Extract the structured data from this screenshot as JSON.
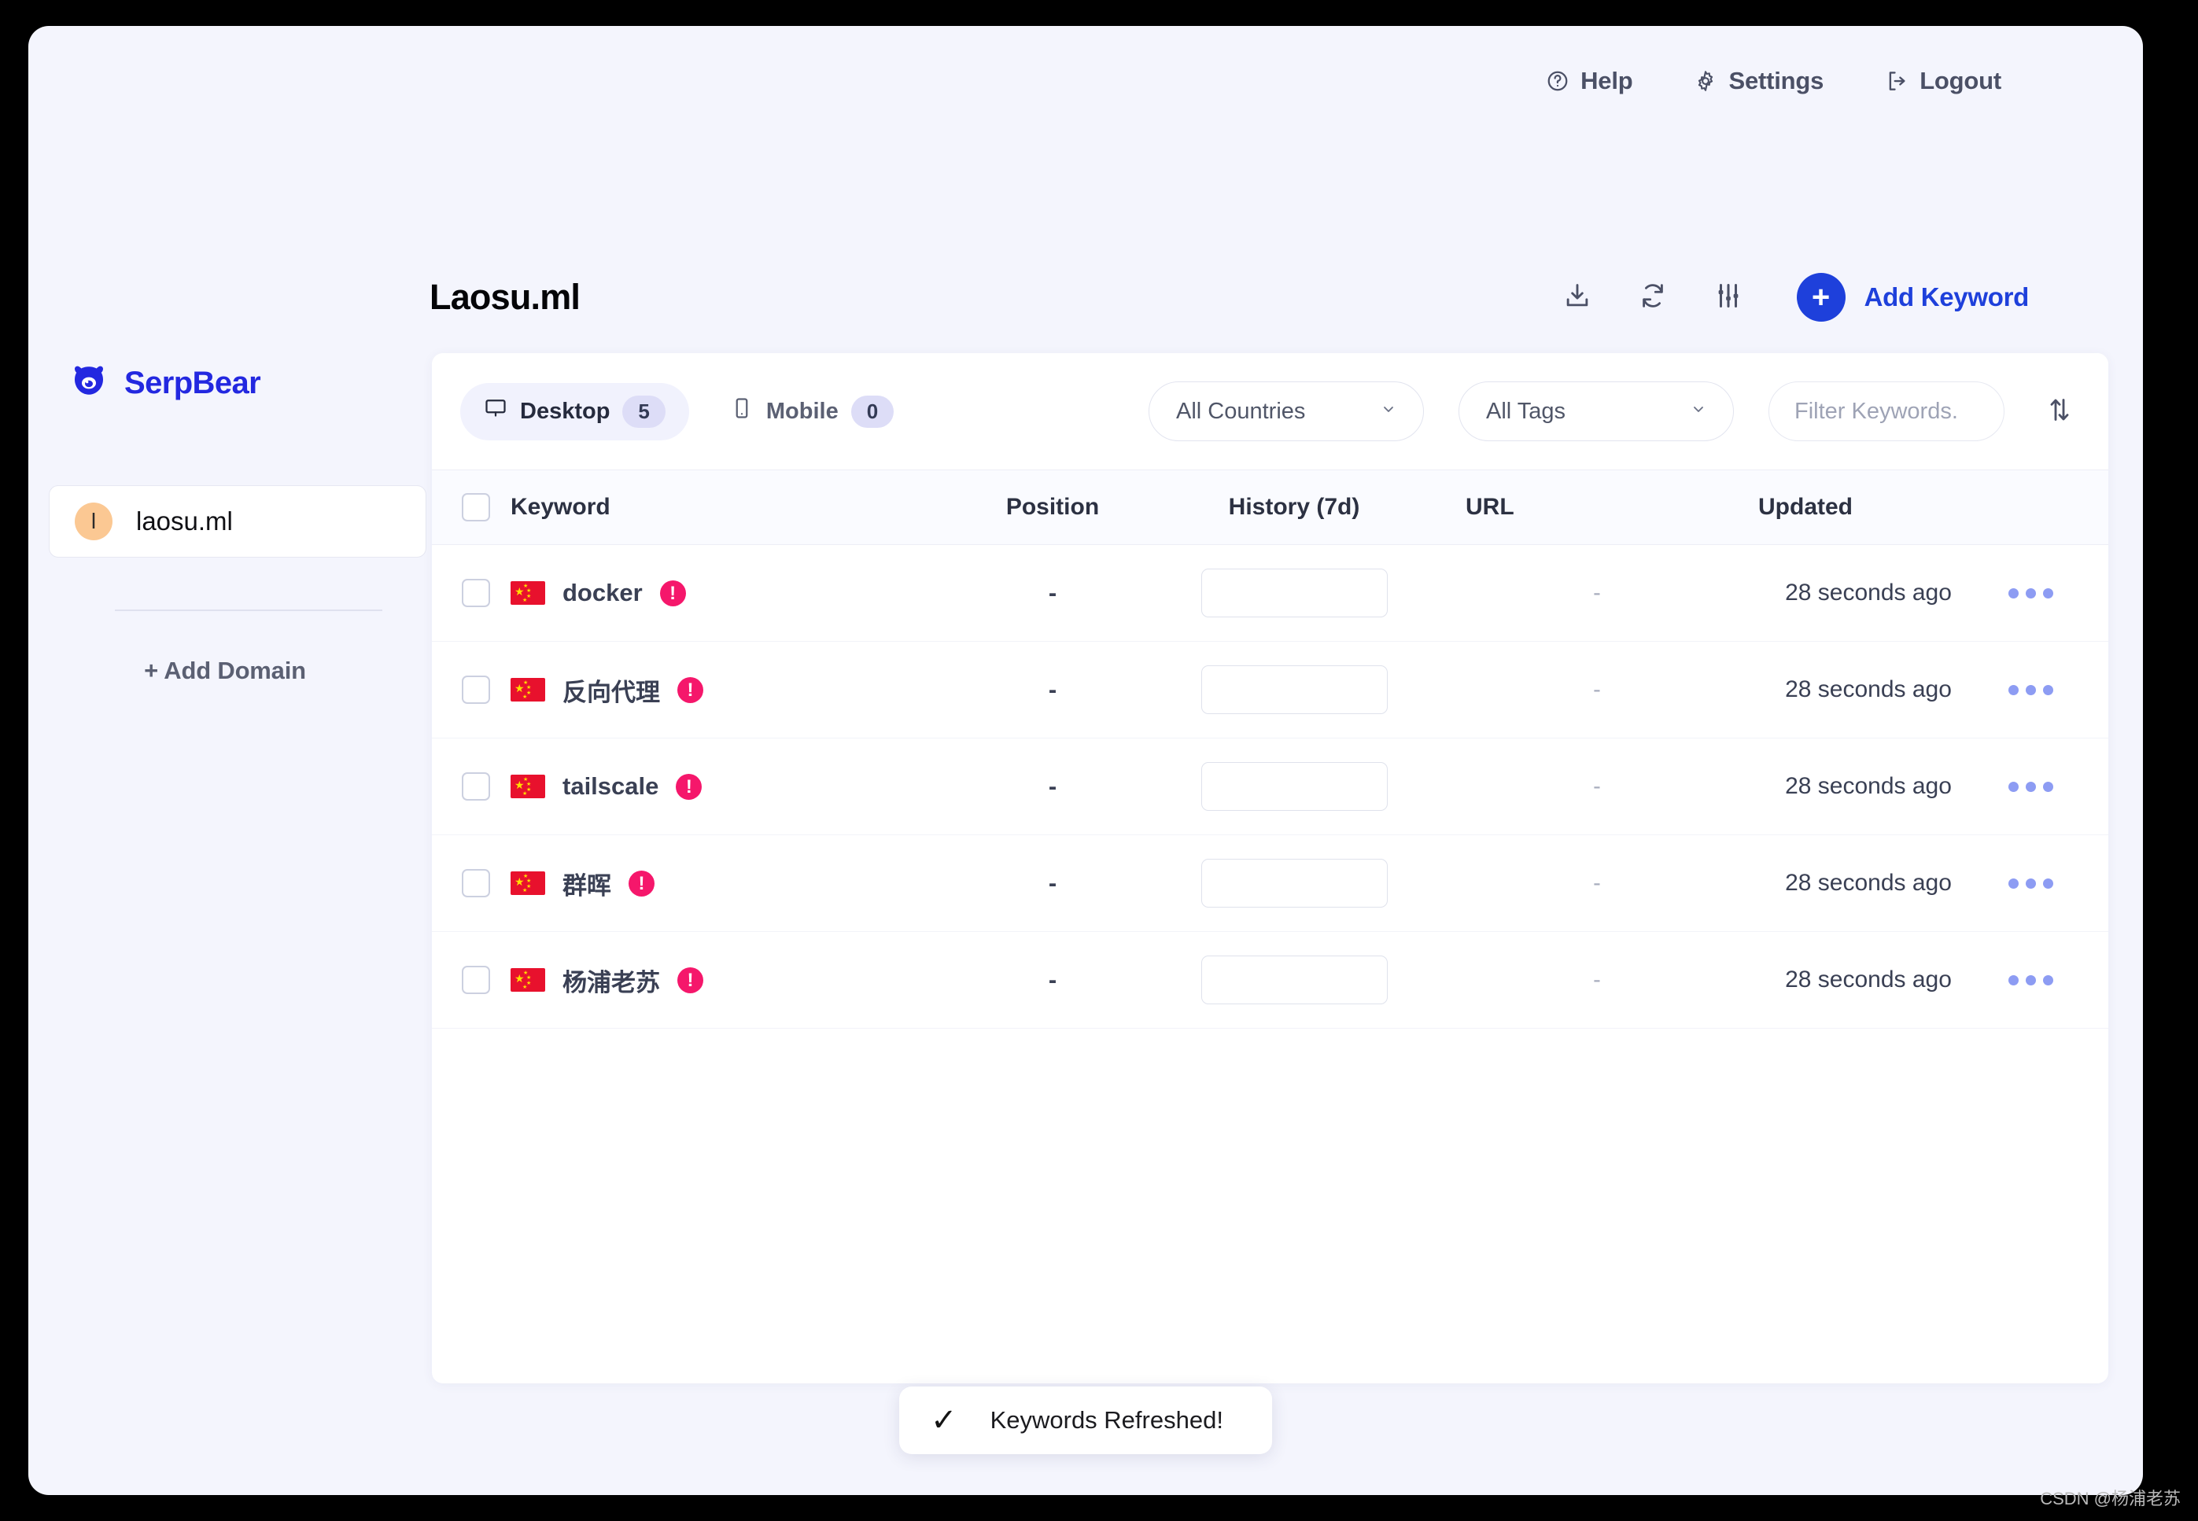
{
  "topnav": {
    "items": [
      {
        "label": "Help",
        "icon": "help-circle-icon"
      },
      {
        "label": "Settings",
        "icon": "gear-icon"
      },
      {
        "label": "Logout",
        "icon": "logout-icon"
      }
    ]
  },
  "sidebar": {
    "brand": "SerpBear",
    "domains": [
      {
        "avatar_letter": "l",
        "label": "laosu.ml"
      }
    ],
    "add_domain_label": "+ Add Domain"
  },
  "header": {
    "title": "Laosu.ml",
    "actions": [
      {
        "name": "export-button",
        "icon": "download-icon"
      },
      {
        "name": "refresh-button",
        "icon": "refresh-icon"
      },
      {
        "name": "settings-sliders-button",
        "icon": "sliders-icon"
      }
    ],
    "add_keyword_plus": "+",
    "add_keyword_label": "Add Keyword"
  },
  "toolbar": {
    "tabs": [
      {
        "label": "Desktop",
        "count": "5",
        "icon": "desktop-icon",
        "active": true
      },
      {
        "label": "Mobile",
        "count": "0",
        "icon": "mobile-icon",
        "active": false
      }
    ],
    "country_filter": "All Countries",
    "tag_filter": "All Tags",
    "search_placeholder": "Filter Keywords.",
    "search_value": "",
    "sort_icon": "sort-arrows-icon"
  },
  "table": {
    "columns": [
      "Keyword",
      "Position",
      "History (7d)",
      "URL",
      "Updated"
    ],
    "rows": [
      {
        "keyword": "docker",
        "country": "CN",
        "position": "-",
        "url": "-",
        "updated": "28 seconds ago"
      },
      {
        "keyword": "反向代理",
        "country": "CN",
        "position": "-",
        "url": "-",
        "updated": "28 seconds ago"
      },
      {
        "keyword": "tailscale",
        "country": "CN",
        "position": "-",
        "url": "-",
        "updated": "28 seconds ago"
      },
      {
        "keyword": "群晖",
        "country": "CN",
        "position": "-",
        "url": "-",
        "updated": "28 seconds ago"
      },
      {
        "keyword": "杨浦老苏",
        "country": "CN",
        "position": "-",
        "url": "-",
        "updated": "28 seconds ago"
      }
    ]
  },
  "toast": {
    "check": "✓",
    "message": "Keywords Refreshed!"
  },
  "watermark": "CSDN @杨浦老苏",
  "colors": {
    "brand_blue": "#2328e0",
    "accent_blue": "#1e40db",
    "warning_pink": "#f5176b",
    "page_bg": "#f4f5fd",
    "avatar_orange": "#fbc893",
    "dots_blue": "#8d9cf3"
  }
}
